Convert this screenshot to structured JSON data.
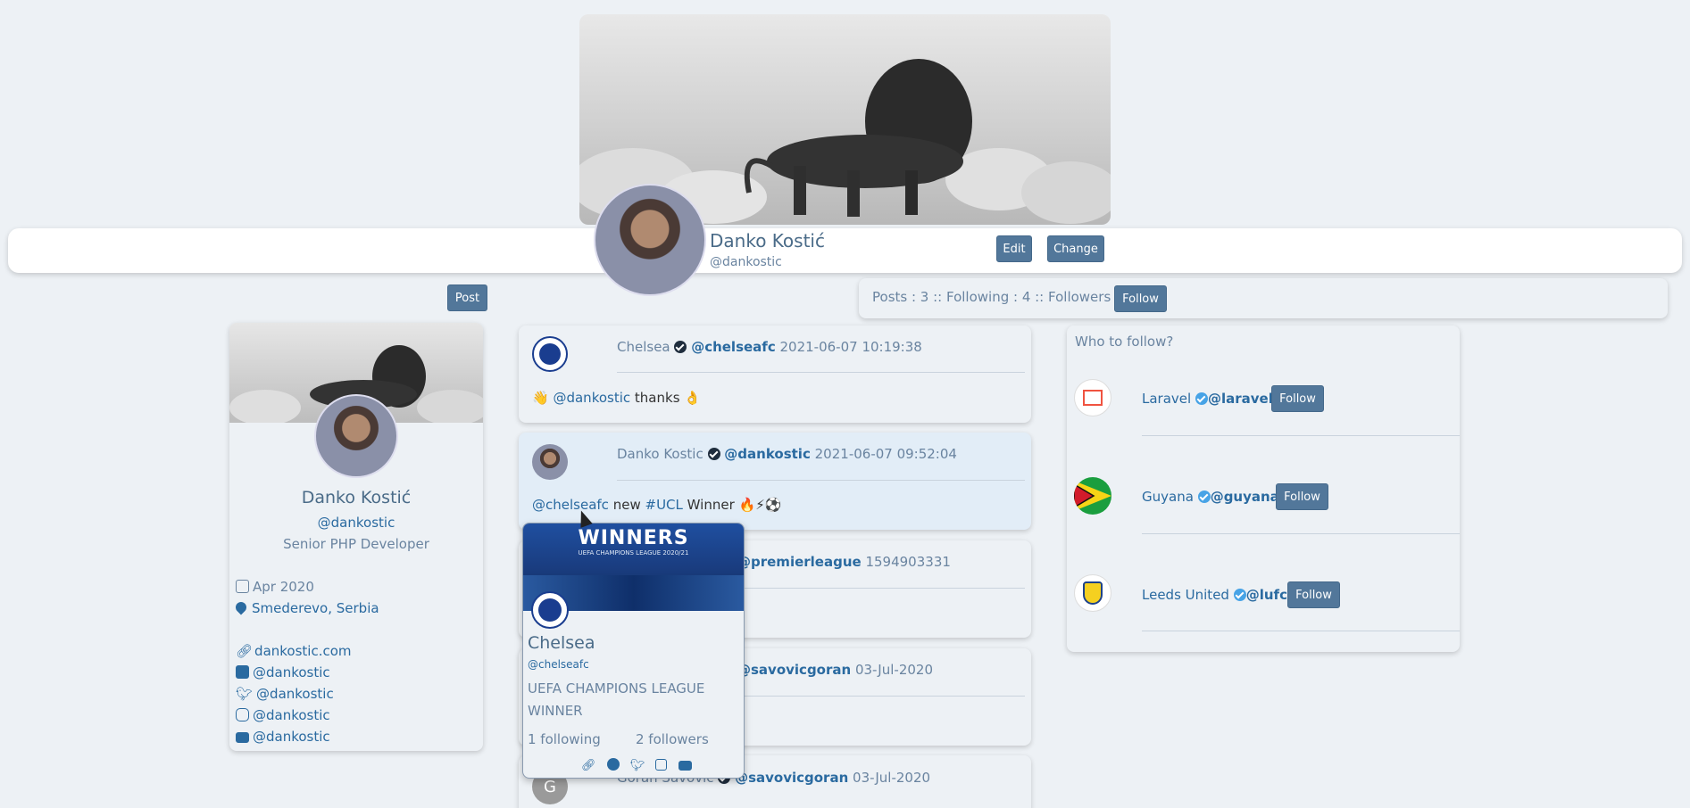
{
  "cover": {
    "alt_icon": "lion-cover-image"
  },
  "profile": {
    "name": "Danko Kostić",
    "handle": "@dankostic",
    "edit_label": "Edit",
    "change_label": "Change",
    "post_label": "Post",
    "stats": "Posts : 3 :: Following : 4 :: Followers : 1",
    "follow_label": "Follow",
    "title": "Senior PHP Developer",
    "joined": "Apr 2020",
    "location": "Smederevo, Serbia",
    "website": "dankostic.com",
    "facebook": "@dankostic",
    "twitter": "@dankostic",
    "instagram": "@dankostic",
    "youtube": "@dankostic"
  },
  "feed": [
    {
      "name": "Chelsea",
      "handle": "@chelseafc",
      "date": "2021-06-07 10:19:38",
      "mention": "@dankostic",
      "text": "thanks",
      "prefix": "👋",
      "suffix": "👌"
    },
    {
      "name": "Danko Kostic",
      "handle": "@dankostic",
      "date": "2021-06-07 09:52:04",
      "mention": "@chelseafc",
      "text": "new",
      "tag": "#UCL",
      "text2": "Winner 🔥⚡⚽"
    },
    {
      "handle": "@premierleague",
      "date": "1594903331"
    },
    {
      "handle": "@savovicgoran",
      "date": "03-Jul-2020"
    },
    {
      "name": "Goran Savovic",
      "handle": "@savovicgoran",
      "date": "03-Jul-2020",
      "avatar_letter": "G"
    }
  ],
  "popup": {
    "banner_text": "WINNERS",
    "banner_sub": "UEFA CHAMPIONS LEAGUE 2020/21",
    "name": "Chelsea",
    "handle": "@chelseafc",
    "bio": "UEFA CHAMPIONS LEAGUE WINNER",
    "following": "1 following",
    "followers": "2 followers"
  },
  "who_to_follow": {
    "title": "Who to follow?",
    "items": [
      {
        "name": "Laravel",
        "handle": "@laravel",
        "button": "Follow"
      },
      {
        "name": "Guyana",
        "handle": "@guyana",
        "button": "Follow"
      },
      {
        "name": "Leeds United",
        "handle": "@lufc",
        "button": "Follow"
      }
    ]
  },
  "colors": {
    "accent": "#52779a",
    "link": "#2a6aa0",
    "bg": "#edf1f5"
  }
}
